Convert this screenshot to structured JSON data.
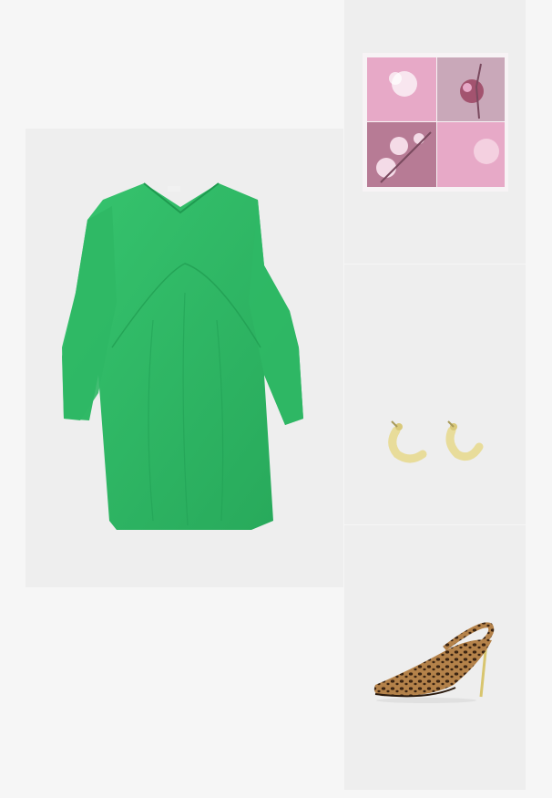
{
  "outfit": {
    "items": [
      {
        "id": "dress",
        "icon": "green-dress-icon",
        "color": "#2fb865"
      },
      {
        "id": "scarf",
        "icon": "orchid-scarf-icon",
        "color": "#e2a9c3"
      },
      {
        "id": "earrings",
        "icon": "gold-hoop-earrings-icon",
        "color": "#e6d692"
      },
      {
        "id": "shoes",
        "icon": "leopard-slingback-icon",
        "color": "#8a5a2e"
      }
    ]
  }
}
